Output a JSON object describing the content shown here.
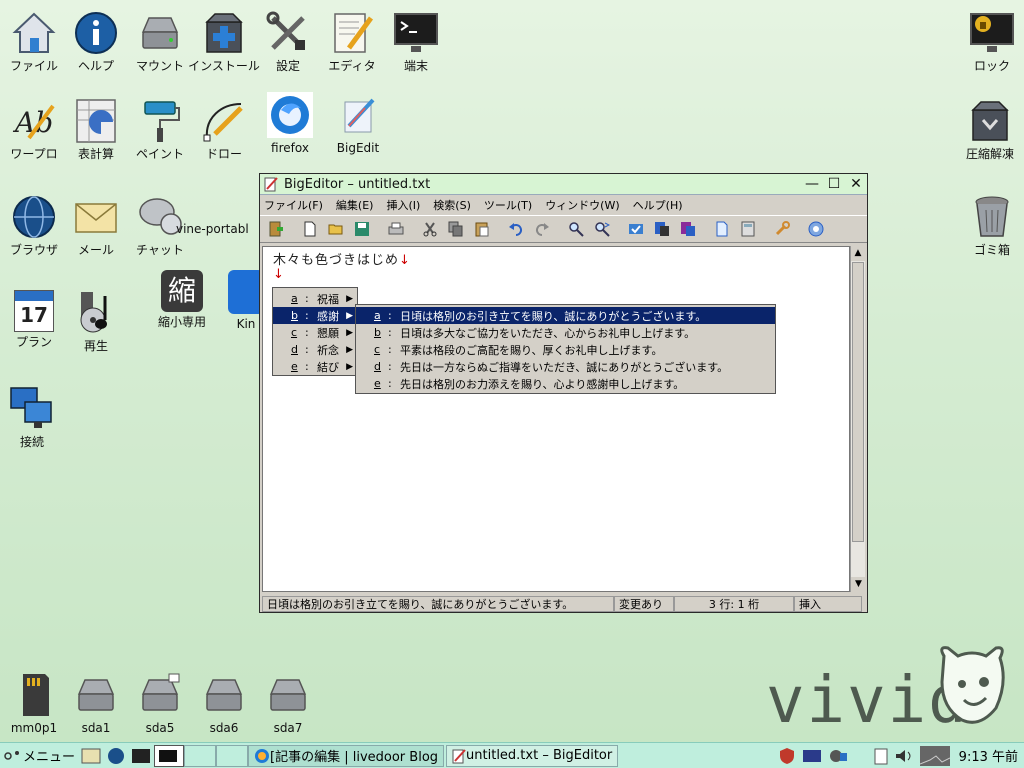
{
  "desktop": {
    "icons": {
      "files": "ファイル",
      "help": "ヘルプ",
      "mount": "マウント",
      "install": "インストール",
      "settings": "設定",
      "editor": "エディタ",
      "terminal": "端末",
      "lock": "ロック",
      "wordpro": "ワープロ",
      "spreadsheet": "表計算",
      "paint": "ペイント",
      "draw": "ドロー",
      "firefox": "firefox",
      "bigedit": "BigEdit",
      "archive": "圧縮解凍",
      "browser": "ブラウザ",
      "mail": "メール",
      "chat": "チャット",
      "vine_portable": "vine-portabl",
      "trash": "ゴミ箱",
      "shrink": "縮小専用",
      "shrink_glyph": "縮",
      "kin": "Kin",
      "plan": "プラン",
      "plan_day": "17",
      "play": "再生",
      "connect": "接続",
      "mm0p1": "mm0p1",
      "sda1": "sda1",
      "sda5": "sda5",
      "sda6": "sda6",
      "sda7": "sda7"
    },
    "logo_text": "vivid"
  },
  "window": {
    "title": "BigEditor – untitled.txt",
    "minimize": "—",
    "maximize": "☐",
    "close": "✕",
    "menu": [
      "ファイル(F)",
      "編集(E)",
      "挿入(I)",
      "検索(S)",
      "ツール(T)",
      "ウィンドウ(W)",
      "ヘルプ(H)"
    ],
    "editor": {
      "line1": "木々も色づきはじめ",
      "eol_mark": "↓",
      "line2": "↓"
    },
    "status": {
      "message": "日頃は格別のお引き立てを賜り、誠にありがとうございます。",
      "modified": "変更あり",
      "position": "3 行: 1 桁",
      "mode": "挿入"
    }
  },
  "menu_categories": [
    {
      "key": "a",
      "label": "祝福"
    },
    {
      "key": "b",
      "label": "感謝"
    },
    {
      "key": "c",
      "label": "懇願"
    },
    {
      "key": "d",
      "label": "祈念"
    },
    {
      "key": "e",
      "label": "結び"
    }
  ],
  "menu_phrases": [
    {
      "key": "a",
      "label": "日頃は格別のお引き立てを賜り、誠にありがとうございます。"
    },
    {
      "key": "b",
      "label": "日頃は多大なご協力をいただき、心からお礼申し上げます。"
    },
    {
      "key": "c",
      "label": "平素は格段のご高配を賜り、厚くお礼申し上げます。"
    },
    {
      "key": "d",
      "label": "先日は一方ならぬご指導をいただき、誠にありがとうございます。"
    },
    {
      "key": "e",
      "label": "先日は格別のお力添えを賜り、心より感謝申し上げます。"
    }
  ],
  "taskbar": {
    "menu_label": "メニュー",
    "task1": "[記事の編集 | livedoor Blog",
    "task2": "untitled.txt – BigEditor",
    "clock": "9:13 午前"
  },
  "colors": {
    "menu_highlight": "#0a246a",
    "desktop": "#d5ecd2",
    "taskbar": "#bfeedd"
  }
}
